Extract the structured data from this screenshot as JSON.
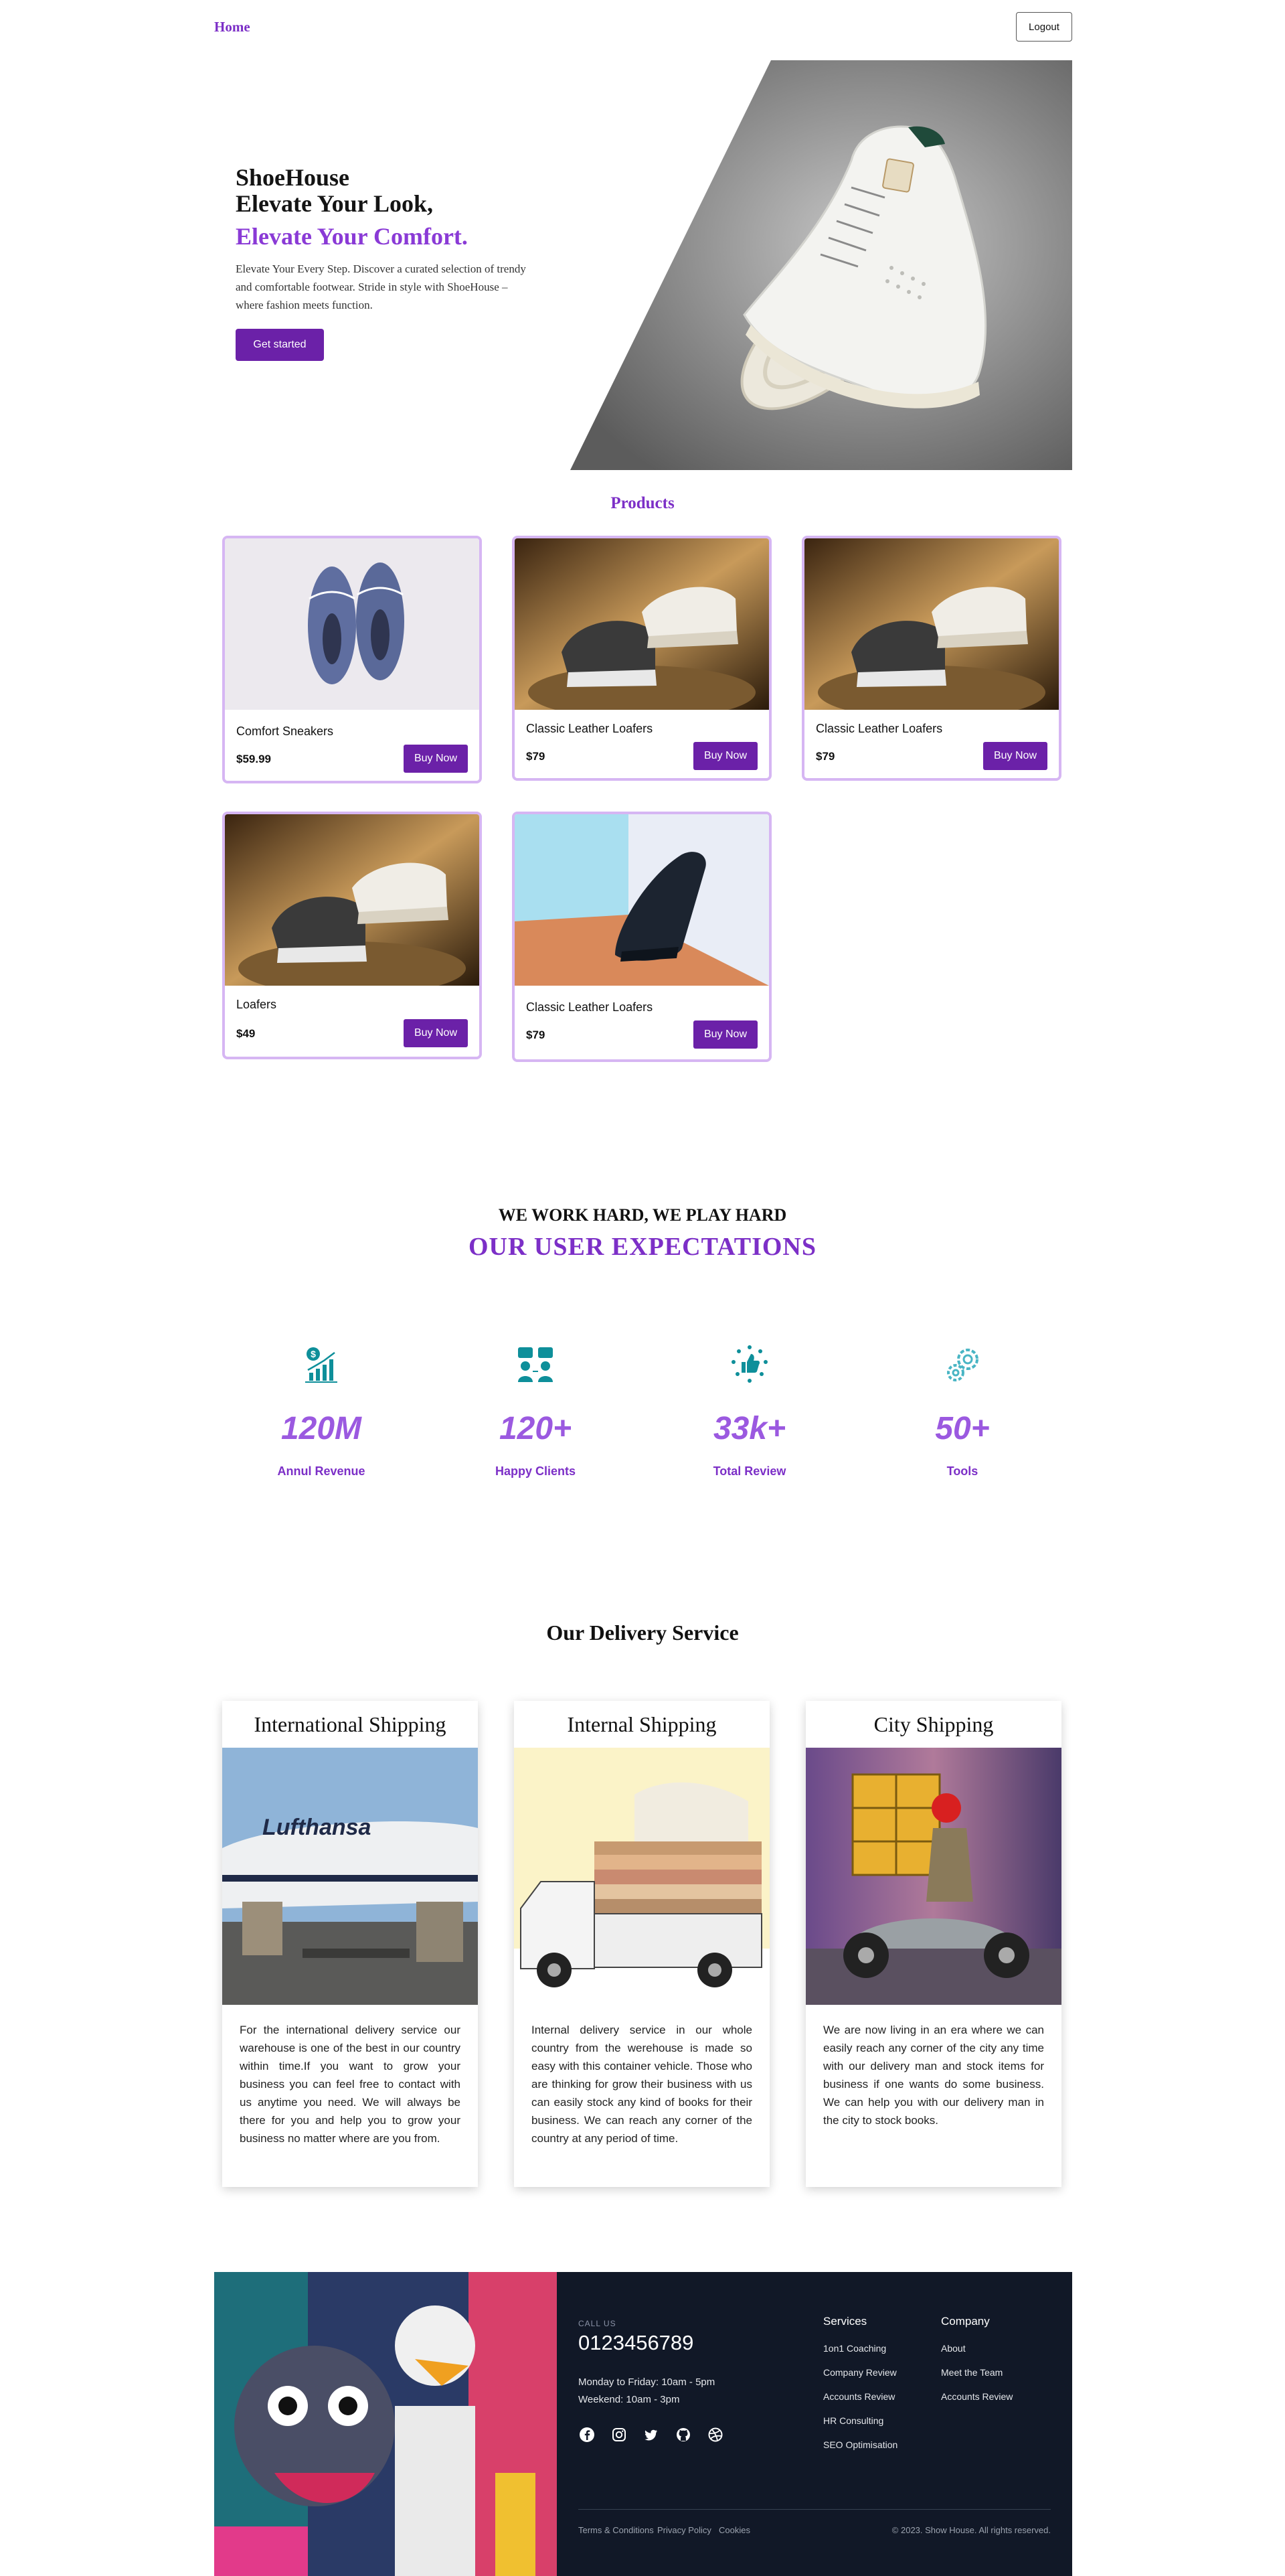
{
  "nav": {
    "home": "Home",
    "logout": "Logout"
  },
  "hero": {
    "brand": "ShoeHouse",
    "headline": "Elevate Your Look,",
    "headline_accent": "Elevate Your Comfort.",
    "description": "Elevate Your Every Step. Discover a curated selection of trendy and comfortable footwear. Stride in style with ShoeHouse – where fashion meets function.",
    "cta": "Get started"
  },
  "products": {
    "title": "Products",
    "items": [
      {
        "name": "Comfort Sneakers",
        "price": "$59.99",
        "button": "Buy Now",
        "image": "blue-sneakers"
      },
      {
        "name": "Classic Leather Loafers",
        "price": "$79",
        "button": "Buy Now",
        "image": "metallic-sneakers"
      },
      {
        "name": "Classic Leather Loafers",
        "price": "$79",
        "button": "Buy Now",
        "image": "metallic-sneakers"
      },
      {
        "name": "Loafers",
        "price": "$49",
        "button": "Buy Now",
        "image": "metallic-sneakers"
      },
      {
        "name": "Classic Leather Loafers",
        "price": "$79",
        "button": "Buy Now",
        "image": "black-woven-loafer"
      }
    ]
  },
  "expectations": {
    "kicker": "WE WORK HARD, WE PLAY HARD",
    "title": "OUR USER EXPECTATIONS",
    "stats": [
      {
        "value": "120M",
        "label": "Annul Revenue",
        "icon": "revenue-chart-icon"
      },
      {
        "value": "120+",
        "label": "Happy Clients",
        "icon": "clients-icon"
      },
      {
        "value": "33k+",
        "label": "Total Review",
        "icon": "thumbs-up-icon"
      },
      {
        "value": "50+",
        "label": "Tools",
        "icon": "gears-icon"
      }
    ]
  },
  "delivery": {
    "title": "Our Delivery Service",
    "cards": [
      {
        "title": "International Shipping",
        "text": "For the international delivery service our warehouse is one of the best in our country within time.If you want to grow your business you can feel free to contact with us anytime you need. We will always be there for you and help you to grow your business no matter where are you from."
      },
      {
        "title": "Internal Shipping",
        "text": "Internal delivery service in our whole country from the werehouse is made so easy with this container vehicle. Those who are thinking for grow their business with us can easily stock any kind of books for their business. We can reach any corner of the country at any period of time."
      },
      {
        "title": "City Shipping",
        "text": "We are now living in an era where we can easily reach any corner of the city any time with our delivery man and stock items for business if one wants do some business. We can help you with our delivery man in the city to stock books."
      }
    ]
  },
  "footer": {
    "call_label": "CALL US",
    "phone": "0123456789",
    "hours_weekday": "Monday to Friday: 10am - 5pm",
    "hours_weekend": "Weekend: 10am - 3pm",
    "socials": [
      "facebook-icon",
      "instagram-icon",
      "twitter-icon",
      "github-icon",
      "dribbble-icon"
    ],
    "services": {
      "heading": "Services",
      "items": [
        "1on1 Coaching",
        "Company Review",
        "Accounts Review",
        "HR Consulting",
        "SEO Optimisation"
      ]
    },
    "company": {
      "heading": "Company",
      "items": [
        "About",
        "Meet the Team",
        "Accounts Review"
      ]
    },
    "legal": {
      "terms": "Terms & Conditions",
      "privacy": "Privacy Policy",
      "cookies": "Cookies"
    },
    "copyright": "© 2023. Show House. All rights reserved."
  },
  "colors": {
    "brand_purple": "#7c2fc7",
    "button_purple": "#6b21a8",
    "stat_purple": "#9b59e0",
    "icon_teal": "#0e8f9a",
    "footer_bg": "#111827"
  }
}
